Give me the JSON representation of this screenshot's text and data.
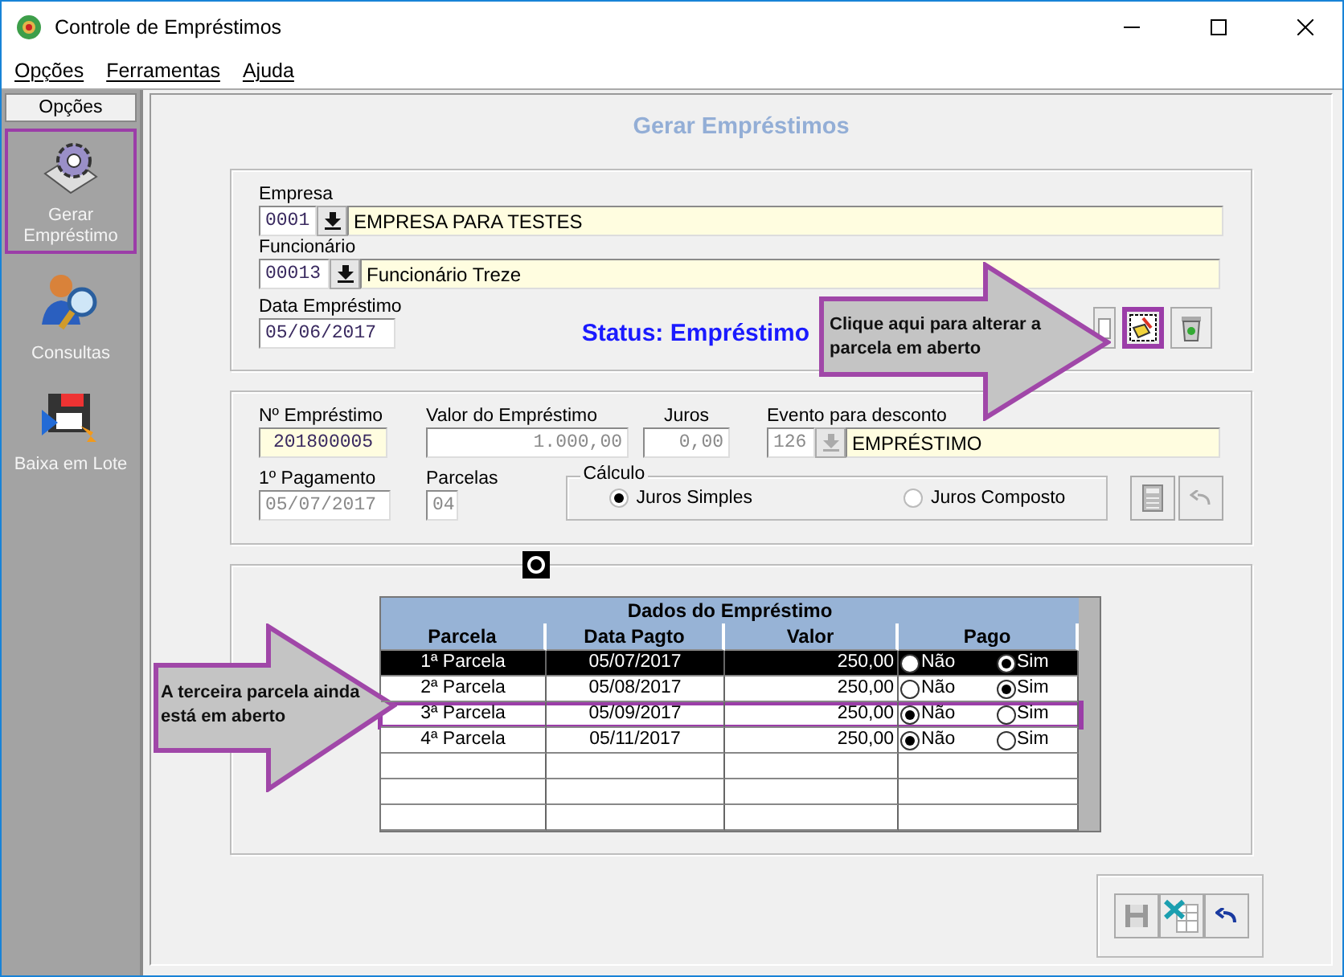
{
  "window": {
    "title": "Controle de Empréstimos"
  },
  "menu": [
    {
      "label": "Opções"
    },
    {
      "label": "Ferramentas"
    },
    {
      "label": "Ajuda"
    }
  ],
  "sidebar": {
    "header": "Opções",
    "items": [
      {
        "label": "Gerar Empréstimo",
        "highlighted": true
      },
      {
        "label": "Consultas",
        "highlighted": false
      },
      {
        "label": "Baixa em Lote",
        "highlighted": false
      }
    ]
  },
  "page_title": "Gerar Empréstimos",
  "empresa": {
    "label": "Empresa",
    "code": "0001",
    "name": "EMPRESA PARA TESTES",
    "disabled": false
  },
  "funcionario": {
    "label": "Funcionário",
    "code": "00013",
    "name": "Funcionário Treze",
    "disabled": false
  },
  "data_emprestimo": {
    "label": "Data Empréstimo",
    "value": "05/06/2017"
  },
  "status": "Status: Empréstimo",
  "toolbar": [
    {
      "highlighted": false
    },
    {
      "highlighted": true
    },
    {
      "highlighted": false
    }
  ],
  "loan": {
    "numero": {
      "label": "Nº Empréstimo",
      "value": "201800005",
      "readonly": true,
      "disabled": false
    },
    "valor": {
      "label": "Valor do Empréstimo",
      "value": "1.000,00",
      "readonly": false,
      "disabled": true
    },
    "juros": {
      "label": "Juros",
      "value": "0,00",
      "disabled": true
    },
    "evento": {
      "label": "Evento para desconto",
      "code": "126",
      "name": "EMPRÉSTIMO",
      "disabled": true
    },
    "primeiro_pagamento": {
      "label": "1º Pagamento",
      "value": "05/07/2017",
      "readonly": false,
      "disabled": true
    },
    "parcelas": {
      "label": "Parcelas",
      "value": "04",
      "readonly": false,
      "disabled": true
    },
    "calculo": {
      "label": "Cálculo",
      "options": [
        {
          "label": "Juros Simples",
          "selected": true
        },
        {
          "label": "Juros Composto",
          "selected": false
        }
      ]
    }
  },
  "table": {
    "title": "Dados do Empréstimo",
    "columns": [
      "Parcela",
      "Data Pagto",
      "Valor",
      "Pago"
    ],
    "rows": [
      {
        "parcela": "1ª Parcela",
        "data": "05/07/2017",
        "valor": "250,00",
        "selected": true,
        "highlighted": false,
        "pago": [
          {
            "label": "Não",
            "selected": false
          },
          {
            "label": "Sim",
            "selected": true
          }
        ]
      },
      {
        "parcela": "2ª Parcela",
        "data": "05/08/2017",
        "valor": "250,00",
        "selected": false,
        "highlighted": false,
        "pago": [
          {
            "label": "Não",
            "selected": false
          },
          {
            "label": "Sim",
            "selected": true
          }
        ]
      },
      {
        "parcela": "3ª Parcela",
        "data": "05/09/2017",
        "valor": "250,00",
        "selected": false,
        "highlighted": true,
        "pago": [
          {
            "label": "Não",
            "selected": true
          },
          {
            "label": "Sim",
            "selected": false
          }
        ]
      },
      {
        "parcela": "4ª Parcela",
        "data": "05/11/2017",
        "valor": "250,00",
        "selected": false,
        "highlighted": false,
        "pago": [
          {
            "label": "Não",
            "selected": true
          },
          {
            "label": "Sim",
            "selected": false
          }
        ]
      }
    ]
  },
  "callouts": [
    {
      "text": "Clique aqui para alterar a parcela em aberto"
    },
    {
      "text": "A terceira parcela ainda está em aberto"
    }
  ]
}
